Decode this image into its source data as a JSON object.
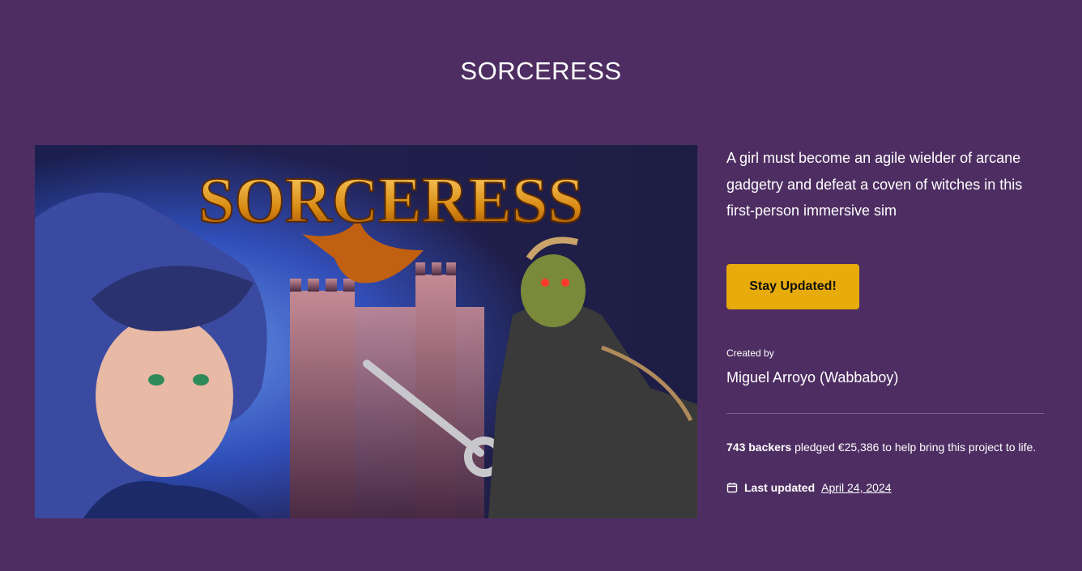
{
  "page": {
    "title": "SORCERESS"
  },
  "hero": {
    "logo_text": "SORCERESS",
    "alt": "Sorceress key art"
  },
  "project": {
    "description": "A girl must become an agile wielder of arcane gadgetry and defeat a coven of witches in this first-person immersive sim",
    "cta_label": "Stay Updated!",
    "created_by_label": "Created by",
    "creator": "Miguel Arroyo (Wabbaboy)",
    "backers": "743 backers",
    "pledge_text": " pledged €25,386 to help bring this project to life.",
    "last_updated_label": "Last updated",
    "last_updated_date": "April 24, 2024",
    "icon": "calendar-icon"
  },
  "colors": {
    "background": "#4e2e62",
    "cta": "#e7ab0b"
  }
}
